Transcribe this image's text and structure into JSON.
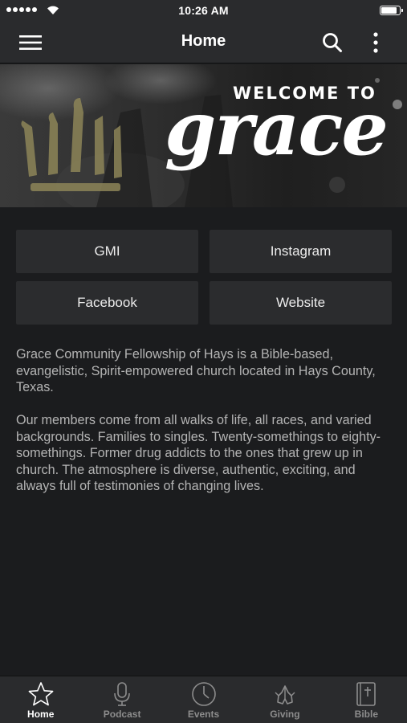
{
  "status_bar": {
    "time": "10:26 AM",
    "battery_level": 0.92
  },
  "nav": {
    "title": "Home",
    "menu_icon": "hamburger-menu-icon",
    "search_icon": "search-icon",
    "more_icon": "more-vertical-icon"
  },
  "hero": {
    "welcome": "WELCOME TO",
    "script": "grace",
    "logo_icon": "crown-icon"
  },
  "buttons": [
    {
      "label": "GMI"
    },
    {
      "label": "Instagram"
    },
    {
      "label": "Facebook"
    },
    {
      "label": "Website"
    }
  ],
  "description": {
    "paragraph_1": "Grace Community Fellowship of Hays is a Bible-based, evangelistic, Spirit-empowered church located in Hays County, Texas.",
    "paragraph_2": "Our members come from all walks of life, all races, and varied backgrounds.  Families to singles.  Twenty-somethings to eighty-somethings.  Former drug addicts to the ones that grew up in church.  The atmosphere is diverse, authentic, exciting, and always full of testimonies of changing lives."
  },
  "tabs": [
    {
      "label": "Home",
      "icon": "star-icon",
      "active": true
    },
    {
      "label": "Podcast",
      "icon": "microphone-icon",
      "active": false
    },
    {
      "label": "Events",
      "icon": "clock-icon",
      "active": false
    },
    {
      "label": "Giving",
      "icon": "praying-hands-icon",
      "active": false
    },
    {
      "label": "Bible",
      "icon": "bible-icon",
      "active": false
    }
  ],
  "colors": {
    "background": "#1b1c1e",
    "bar": "#2a2b2d",
    "button": "#2b2c2e",
    "crown_gold": "#8d8558",
    "text_muted": "#b4b4b4"
  }
}
